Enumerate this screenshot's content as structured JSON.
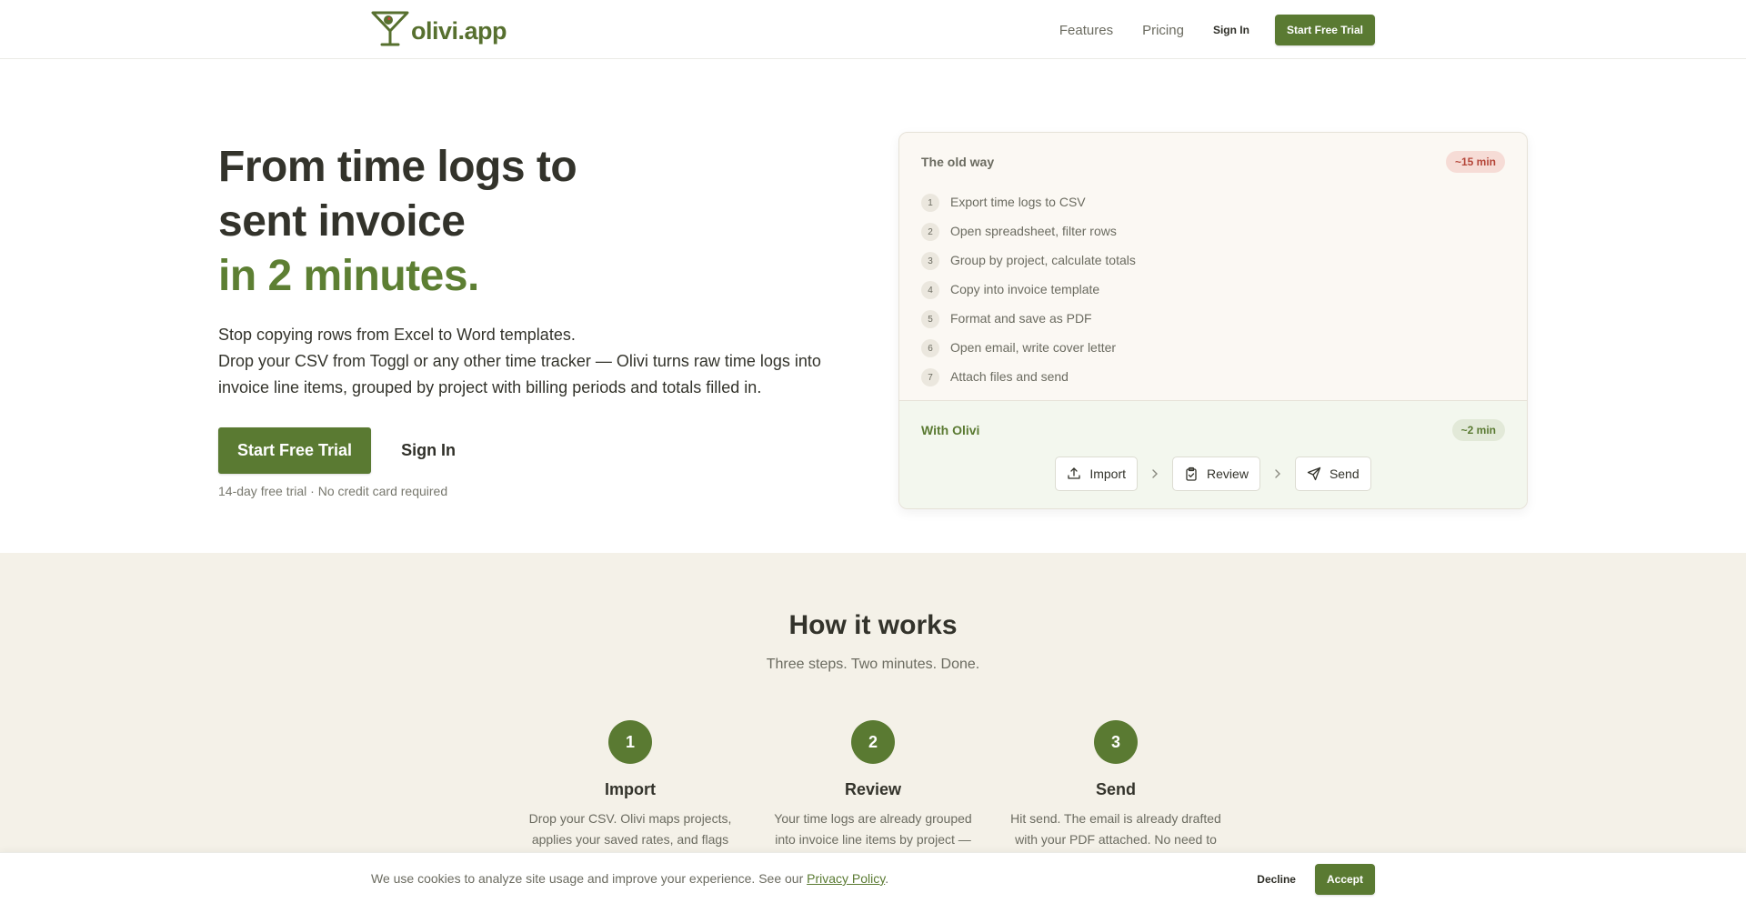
{
  "header": {
    "logo_text": "olivi.app",
    "logo_icon": "martini-glass-icon",
    "nav_features": "Features",
    "nav_pricing": "Pricing",
    "nav_signin": "Sign In",
    "nav_cta": "Start Free Trial"
  },
  "hero": {
    "title_line1": "From time logs to",
    "title_line2": "sent invoice",
    "title_accent": "in 2 minutes.",
    "sub_line1": "Stop copying rows from Excel to Word templates.",
    "sub_line2": "Drop your CSV from Toggl or any other time tracker — Olivi turns raw time logs into",
    "sub_line3": "invoice line items, grouped by project with billing periods and totals filled in.",
    "cta_primary": "Start Free Trial",
    "cta_secondary": "Sign In",
    "note": "14-day free trial · No credit card required"
  },
  "comparison": {
    "old_label": "The old way",
    "old_time": "~15 min",
    "old_steps": [
      {
        "num": "1",
        "text": "Export time logs to CSV"
      },
      {
        "num": "2",
        "text": "Open spreadsheet, filter rows"
      },
      {
        "num": "3",
        "text": "Group by project, calculate totals"
      },
      {
        "num": "4",
        "text": "Copy into invoice template"
      },
      {
        "num": "5",
        "text": "Format and save as PDF"
      },
      {
        "num": "6",
        "text": "Open email, write cover letter"
      },
      {
        "num": "7",
        "text": "Attach files and send"
      }
    ],
    "new_label": "With Olivi",
    "new_time": "~2 min",
    "flow": [
      {
        "label": "Import",
        "icon": "upload-icon"
      },
      {
        "label": "Review",
        "icon": "clipboard-check-icon"
      },
      {
        "label": "Send",
        "icon": "send-icon"
      }
    ]
  },
  "how": {
    "title": "How it works",
    "subtitle": "Three steps. Two minutes. Done.",
    "steps": [
      {
        "num": "1",
        "name": "Import",
        "desc_line1": "Drop your CSV. Olivi maps projects,",
        "desc_line2": "applies your saved rates, and flags"
      },
      {
        "num": "2",
        "name": "Review",
        "desc_line1": "Your time logs are already grouped",
        "desc_line2": "into invoice line items by project —"
      },
      {
        "num": "3",
        "name": "Send",
        "desc_line1": "Hit send. The email is already drafted",
        "desc_line2": "with your PDF attached. No need to"
      }
    ]
  },
  "cookie": {
    "text": "We use cookies to analyze site usage and improve your experience. See our",
    "link": "Privacy Policy",
    "period": ".",
    "decline": "Decline",
    "accept": "Accept"
  },
  "colors": {
    "brand": "#5a7a32",
    "section_bg": "#f4f1e8",
    "badge_red": "#b5473a"
  }
}
